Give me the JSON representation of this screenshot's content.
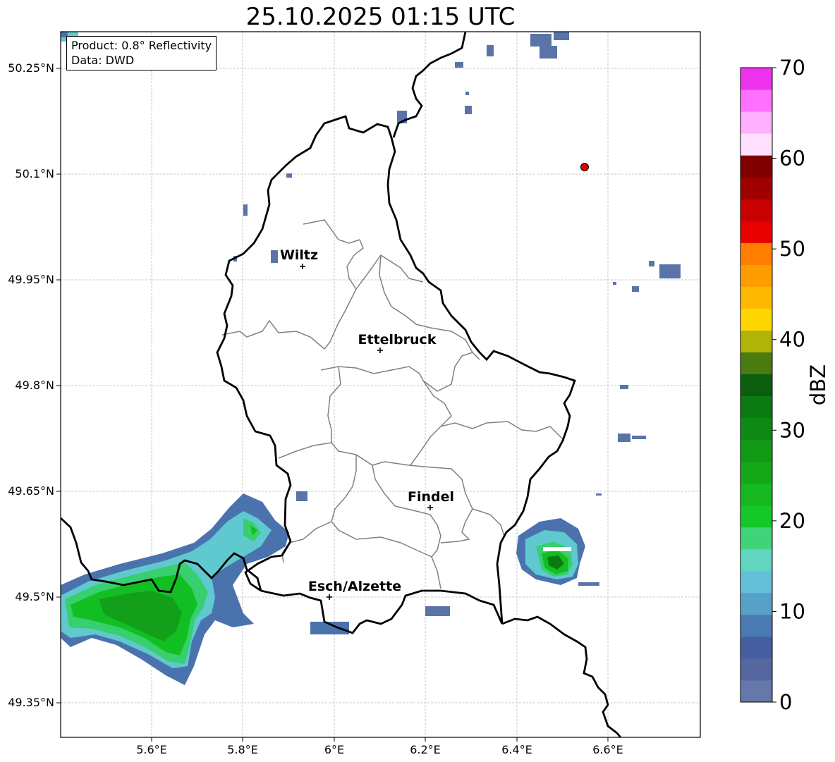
{
  "title": "25.10.2025 01:15 UTC",
  "info": {
    "product": "Product: 0.8° Reflectivity",
    "data": "Data: DWD"
  },
  "lat_ticks": [
    "50.25°N",
    "50.1°N",
    "49.95°N",
    "49.8°N",
    "49.65°N",
    "49.5°N",
    "49.35°N"
  ],
  "lon_ticks": [
    "5.6°E",
    "5.8°E",
    "6°E",
    "6.2°E",
    "6.4°E",
    "6.6°E"
  ],
  "cities": [
    {
      "name": "Wiltz"
    },
    {
      "name": "Ettelbruck"
    },
    {
      "name": "Findel"
    },
    {
      "name": "Esch/Alzette"
    }
  ],
  "radar_site_color": "#e00000",
  "colorbar": {
    "label": "dBZ",
    "ticks": [
      "0",
      "10",
      "20",
      "30",
      "40",
      "50",
      "60",
      "70"
    ],
    "colors": [
      "#6677aa",
      "#55679e",
      "#465fa2",
      "#4a7ab2",
      "#57a0c8",
      "#64c0d8",
      "#60d6c0",
      "#40d47a",
      "#14c828",
      "#16b820",
      "#14a818",
      "#129a16",
      "#0e8a14",
      "#0b7a12",
      "#0a5e0e",
      "#4a7a10",
      "#b0b408",
      "#ffd700",
      "#ffb800",
      "#ff9c00",
      "#ff7e00",
      "#e60000",
      "#c80000",
      "#a00000",
      "#800000",
      "#ffe0ff",
      "#ffb0ff",
      "#ff70ff",
      "#ee33ee"
    ]
  }
}
